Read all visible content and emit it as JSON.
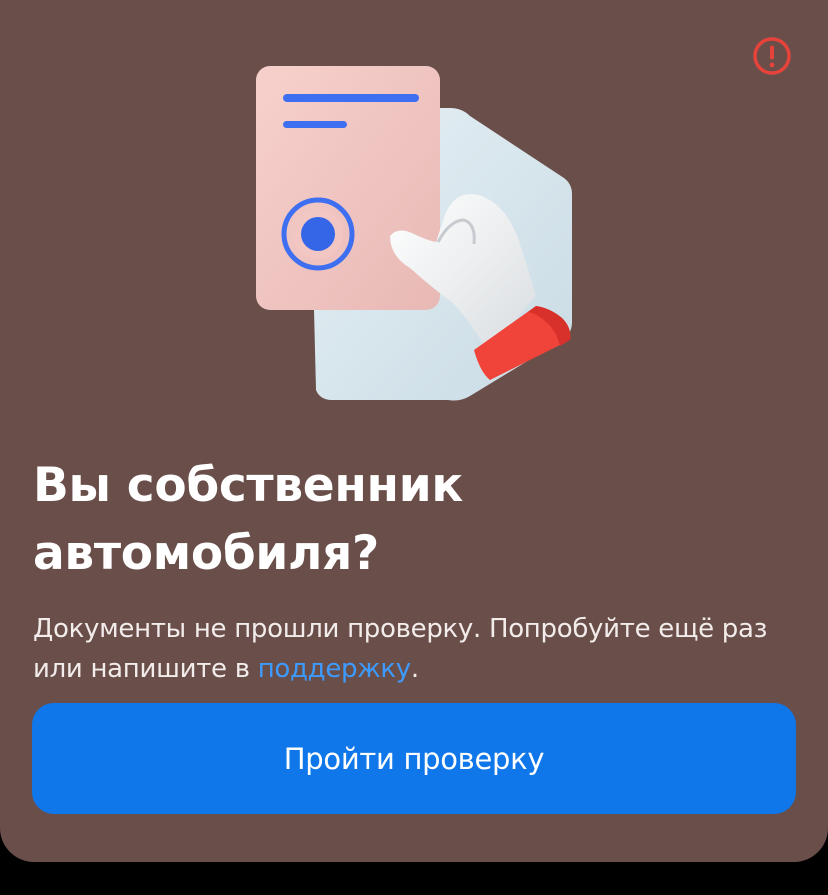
{
  "dialog": {
    "title_line1": "Вы собственник",
    "title_line2": "автомобиля?",
    "description_prefix": "Документы не прошли проверку. Попробуйте ещё раз или напишите в ",
    "support_link": "поддержку",
    "description_suffix": ".",
    "cta_label": "Пройти проверку",
    "status_icon": "alert-circle-icon",
    "illustration": "document-in-hand-illustration"
  },
  "colors": {
    "card_background": "#6a4e4a",
    "accent": "#0f77ea",
    "link": "#3d9bff",
    "alert": "#e8433b",
    "page_background": "#000000"
  }
}
